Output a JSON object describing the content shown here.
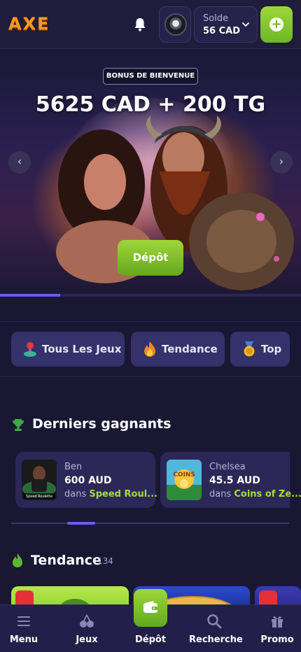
{
  "header": {
    "logo": "AXE",
    "balance_label": "Solde",
    "balance_value": "56 CAD"
  },
  "hero": {
    "badge": "BONUS DE BIENVENUE",
    "title": "5625 CAD + 200 TG",
    "cta": "Dépôt",
    "prev_arrow": "‹",
    "next_arrow": "›",
    "carousel_progress": 0.2
  },
  "categories": [
    {
      "label": "Tous Les Jeux",
      "icon": "joystick-icon"
    },
    {
      "label": "Tendance",
      "icon": "fire-icon"
    },
    {
      "label": "Top",
      "icon": "medal-icon"
    }
  ],
  "winners": {
    "title": "Derniers gagnants",
    "icon": "trophy-icon",
    "items": [
      {
        "name": "Ben",
        "amount": "600 AUD",
        "prefix": "dans",
        "game": "Speed Roul...",
        "thumb_caption": "Speed Roulette"
      },
      {
        "name": "Chelsea",
        "amount": "45.5 AUD",
        "prefix": "dans",
        "game": "Coins of Ze...",
        "thumb_caption": "COINS"
      }
    ]
  },
  "trending": {
    "title": "Tendance",
    "count": "134",
    "icon": "flame-icon"
  },
  "bottom_nav": [
    {
      "label": "Menu",
      "icon": "menu-icon"
    },
    {
      "label": "Jeux",
      "icon": "cherries-icon"
    },
    {
      "label": "Dépôt",
      "icon": "wallet-icon"
    },
    {
      "label": "Recherche",
      "icon": "search-icon"
    },
    {
      "label": "Promo",
      "icon": "gift-icon"
    }
  ],
  "colors": {
    "background": "#1a1733",
    "accent_green": "#8cc832",
    "accent_purple": "#6a5cf0",
    "logo_orange": "#f59a1e",
    "card": "#35316a"
  }
}
